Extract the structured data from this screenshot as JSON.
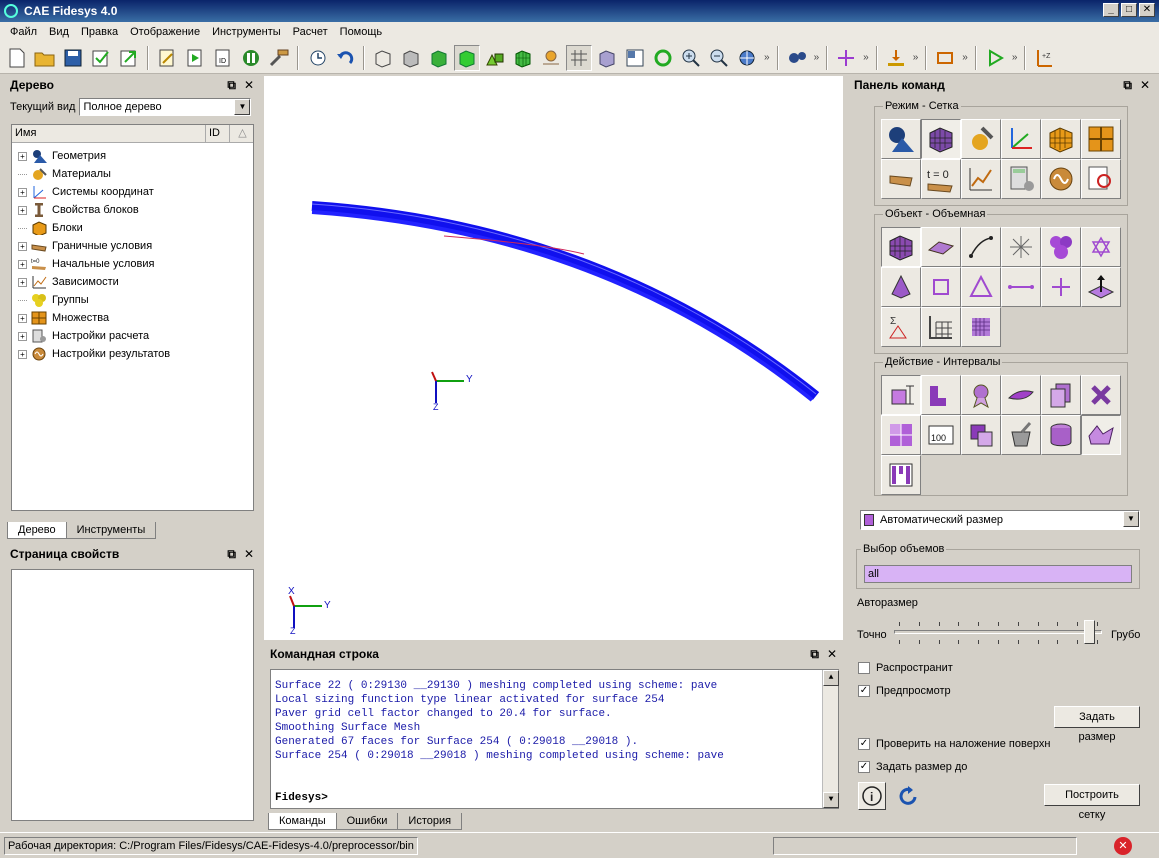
{
  "window": {
    "title": "CAE Fidesys 4.0"
  },
  "menu": [
    "Файл",
    "Вид",
    "Правка",
    "Отображение",
    "Инструменты",
    "Расчет",
    "Помощь"
  ],
  "tree_panel": {
    "title": "Дерево",
    "view_label": "Текущий вид",
    "view_value": "Полное дерево",
    "col_name": "Имя",
    "col_id": "ID",
    "items": [
      {
        "label": "Геометрия",
        "expandable": true
      },
      {
        "label": "Материалы",
        "expandable": false
      },
      {
        "label": "Системы координат",
        "expandable": true
      },
      {
        "label": "Свойства блоков",
        "expandable": true
      },
      {
        "label": "Блоки",
        "expandable": false
      },
      {
        "label": "Граничные условия",
        "expandable": true
      },
      {
        "label": "Начальные условия",
        "expandable": true
      },
      {
        "label": "Зависимости",
        "expandable": true
      },
      {
        "label": "Группы",
        "expandable": false
      },
      {
        "label": "Множества",
        "expandable": true
      },
      {
        "label": "Настройки расчета",
        "expandable": true
      },
      {
        "label": "Настройки результатов",
        "expandable": true
      }
    ],
    "tabs": [
      "Дерево",
      "Инструменты"
    ]
  },
  "props_panel": {
    "title": "Страница свойств"
  },
  "command_panel": {
    "title": "Командная строка",
    "lines": [
      "Surface 22 ( 0:29130 __29130 ) meshing completed using scheme: pave",
      "Local sizing function type linear activated for surface 254",
      "Paver grid cell factor changed to 20.4 for surface.",
      "Smoothing Surface Mesh",
      "Generated 67 faces for Surface 254 ( 0:29018 __29018 ).",
      "Surface 254 ( 0:29018 __29018 ) meshing completed using scheme: pave"
    ],
    "prompt": "Fidesys>",
    "tabs": [
      "Команды",
      "Ошибки",
      "История"
    ]
  },
  "right_panel": {
    "title": "Панель команд",
    "mode_group": "Режим - Сетка",
    "object_group": "Объект - Объемная",
    "action_group": "Действие - Интервалы",
    "t0_label": "t = 0",
    "dropdown_value": "Автоматический размер",
    "volume_select_label": "Выбор объемов",
    "volume_select_value": "all",
    "autosize_label": "Авторазмер",
    "slider_min_label": "Точно",
    "slider_max_label": "Грубо",
    "slider_value": 0.96,
    "propagate_label": "Распространит",
    "propagate_checked": false,
    "preview_label": "Предпросмотр",
    "preview_checked": true,
    "set_size_button": "Задать размер",
    "check_overlap_label": "Проверить на наложение поверхн",
    "check_overlap_checked": true,
    "set_size_to_label": "Задать размер до",
    "set_size_to_checked": true,
    "build_mesh_button": "Построить сетку"
  },
  "viewport": {
    "axis_x": "X",
    "axis_y": "Y",
    "axis_z": "Z"
  },
  "status": {
    "work_dir": "Рабочая директория: C:/Program Files/Fidesys/CAE-Fidesys-4.0/preprocessor/bin"
  },
  "colors": {
    "mesh_blue": "#1010ee",
    "titlebar": "#0a246a",
    "accent_purple": "#d8b3f5"
  }
}
